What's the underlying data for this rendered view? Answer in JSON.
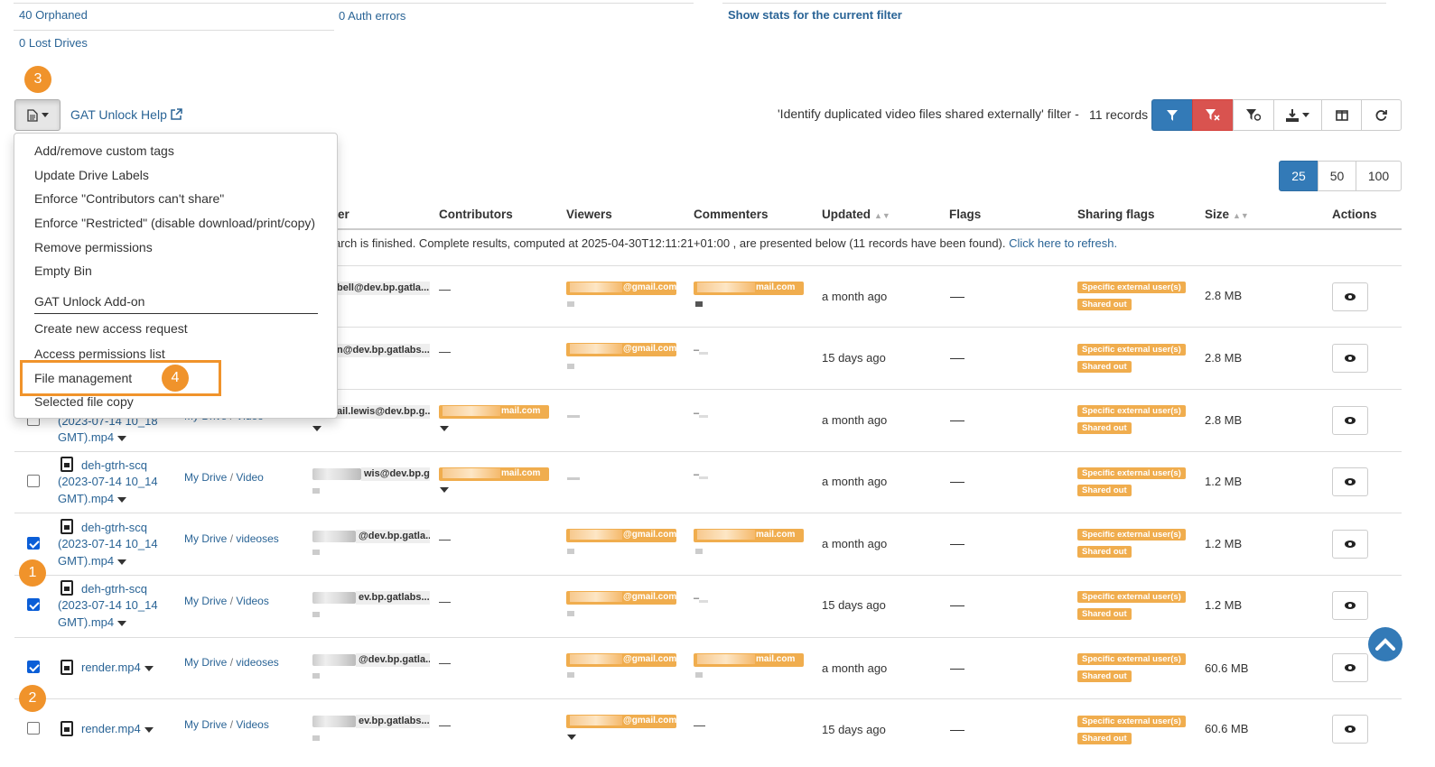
{
  "stats": {
    "orphaned": "40 Orphaned",
    "auth_errors": "0 Auth errors",
    "show_stats": "Show stats for the current filter",
    "lost_drives": "0 Lost Drives"
  },
  "toolbar": {
    "help_link": "GAT Unlock Help",
    "filter_text": "'Identify duplicated video files shared externally' filter -",
    "records": "11 records"
  },
  "callouts": [
    "3",
    "4",
    "1",
    "2"
  ],
  "page_sizes": [
    "25",
    "50",
    "100"
  ],
  "menu": {
    "items": [
      "Add/remove custom tags",
      "Update Drive Labels",
      "Enforce \"Contributors can't share\"",
      "Enforce \"Restricted\" (disable download/print/copy)",
      "Remove permissions",
      "Empty Bin",
      "GAT Unlock Add-on",
      "Create new access request",
      "Access permissions list",
      "File management",
      "Selected file copy"
    ]
  },
  "table": {
    "headers": [
      "er",
      "Contributors",
      "Viewers",
      "Commenters",
      "Updated",
      "Flags",
      "Sharing flags",
      "Size",
      "Actions"
    ],
    "notice_prefix": "arch is finished. Complete results, computed at 2025-04-30T12:11:21+01:00 , are presented below (11 records have been found).",
    "notice_link": "Click here to refresh.",
    "rows": [
      {
        "owner": "bell@dev.bp.gatla...",
        "viewer": "@gmail.com",
        "commenter": "mail.com",
        "updated": "a month ago",
        "size": "2.8 MB",
        "contributor": "—"
      },
      {
        "owner": "n@dev.bp.gatlabs....",
        "viewer": "@gmail.com",
        "commenter": "",
        "updated": "15 days ago",
        "size": "2.8 MB",
        "contributor": "—"
      },
      {
        "file1": "(2023-07-14 10_18",
        "file2": "GMT).mp4",
        "path_a": "My Drive",
        "path_b": "Video",
        "owner": "ail.lewis@dev.bp.g...",
        "contributor_tag": "mail.com",
        "updated": "a month ago",
        "size": "2.8 MB",
        "checked": false
      },
      {
        "file0": "deh-gtrh-scq",
        "file1": "(2023-07-14 10_14",
        "file2": "GMT).mp4",
        "path_a": "My Drive",
        "path_b": "Video",
        "owner": "wis@dev.bp.g...",
        "contributor_tag": "mail.com",
        "updated": "a month ago",
        "size": "1.2 MB",
        "checked": false
      },
      {
        "file0": "deh-gtrh-scq",
        "file1": "(2023-07-14 10_14",
        "file2": "GMT).mp4",
        "path_a": "My Drive",
        "path_b": "videoses",
        "owner": "@dev.bp.gatla...",
        "contributor": "—",
        "viewer": "@gmail.com",
        "commenter": "mail.com",
        "updated": "a month ago",
        "size": "1.2 MB",
        "checked": true
      },
      {
        "file0": "deh-gtrh-scq",
        "file1": "(2023-07-14 10_14",
        "file2": "GMT).mp4",
        "path_a": "My Drive",
        "path_b": "Videos",
        "owner": "ev.bp.gatlabs....",
        "contributor": "—",
        "viewer": "@gmail.com",
        "updated": "15 days ago",
        "size": "1.2 MB",
        "checked": true
      },
      {
        "file0": "render.mp4",
        "path_a": "My Drive",
        "path_b": "videoses",
        "owner": "@dev.bp.gatla...",
        "contributor": "—",
        "viewer": "@gmail.com",
        "commenter": "mail.com",
        "updated": "a month ago",
        "size": "60.6 MB",
        "checked": true
      },
      {
        "file0": "render.mp4",
        "path_a": "My Drive",
        "path_b": "Videos",
        "owner": "ev.bp.gatlabs....",
        "contributor": "—",
        "viewer": "@gmail.com",
        "commenter": "—",
        "updated": "15 days ago",
        "size": "60.6 MB",
        "checked": false
      }
    ],
    "sharing_flag_1": "Specific external user(s)",
    "sharing_flag_2": "Shared out",
    "path_sep": "/"
  },
  "icons": [
    "file-icon",
    "caret-down-icon",
    "external-link-icon",
    "filter-icon",
    "clear-filter-icon",
    "filter-settings-icon",
    "export-icon",
    "columns-icon",
    "refresh-icon",
    "eye-icon",
    "scroll-top-icon",
    "video-file-icon"
  ]
}
